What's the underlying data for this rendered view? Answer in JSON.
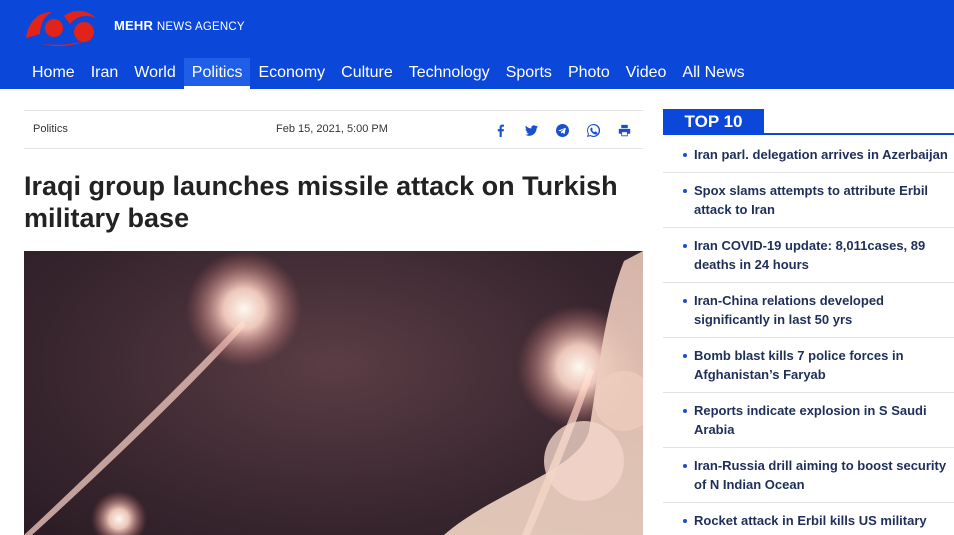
{
  "brand": {
    "name_bold": "MEHR",
    "name_rest": "NEWS AGENCY"
  },
  "nav": [
    "Home",
    "Iran",
    "World",
    "Politics",
    "Economy",
    "Culture",
    "Technology",
    "Sports",
    "Photo",
    "Video",
    "All News"
  ],
  "nav_active": "Politics",
  "article": {
    "category": "Politics",
    "date": "Feb 15, 2021, 5:00 PM",
    "share_icons": [
      "facebook-icon",
      "twitter-icon",
      "telegram-icon",
      "whatsapp-icon",
      "print-icon"
    ],
    "title": "Iraqi group launches missile attack on Turkish military base"
  },
  "sidebar": {
    "heading": "TOP 10",
    "items": [
      "Iran parl. delegation arrives in Azerbaijan",
      "Spox slams attempts to attribute Erbil attack to Iran",
      "Iran COVID-19 update: 8,011cases, 89 deaths in 24 hours",
      "Iran-China relations developed significantly in last 50 yrs",
      "Bomb blast kills 7 police forces in Afghanistan’s Faryab",
      "Reports indicate explosion in S Saudi Arabia",
      "Iran-Russia drill aiming to boost security of N Indian Ocean",
      "Rocket attack in Erbil kills US military"
    ]
  },
  "colors": {
    "brand_blue": "#0b47d8",
    "accent": "#e2231a"
  }
}
